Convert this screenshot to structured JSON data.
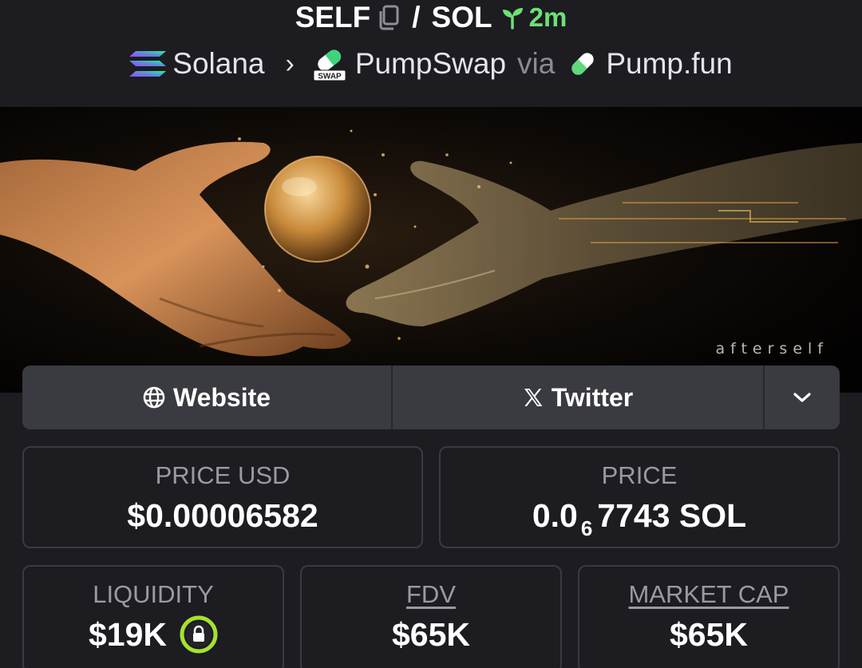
{
  "pair": {
    "base": "SELF",
    "separator": "/",
    "quote": "SOL",
    "age": "2m"
  },
  "breadcrumb": {
    "chain": "Solana",
    "dex": "PumpSwap",
    "via": "via",
    "launchpad": "Pump.fun"
  },
  "banner": {
    "watermark": "afterself"
  },
  "links": {
    "website": "Website",
    "twitter": "Twitter"
  },
  "stats": {
    "price_usd_label": "PRICE USD",
    "price_usd": "$0.00006582",
    "price_label": "PRICE",
    "price_prefix": "0.0",
    "price_zero_count": "6",
    "price_suffix": "7743 SOL",
    "liquidity_label": "LIQUIDITY",
    "liquidity": "$19K",
    "fdv_label": "FDV",
    "fdv": "$65K",
    "market_cap_label": "MARKET CAP",
    "market_cap": "$65K"
  },
  "colors": {
    "background": "#1c1c21",
    "age_green": "#6ee075",
    "card_border": "#3a3a42",
    "button_bg": "#3a3a41",
    "lock_green": "#a6e22e"
  },
  "icons": {
    "copy": "copy-icon",
    "seedling": "seedling-icon",
    "solana": "solana-logo",
    "pumpswap": "pumpswap-logo",
    "pumpfun": "pumpfun-pill-logo",
    "globe": "globe-icon",
    "x": "x-logo-icon",
    "chevron": "chevron-down-icon",
    "lock": "lock-icon"
  }
}
